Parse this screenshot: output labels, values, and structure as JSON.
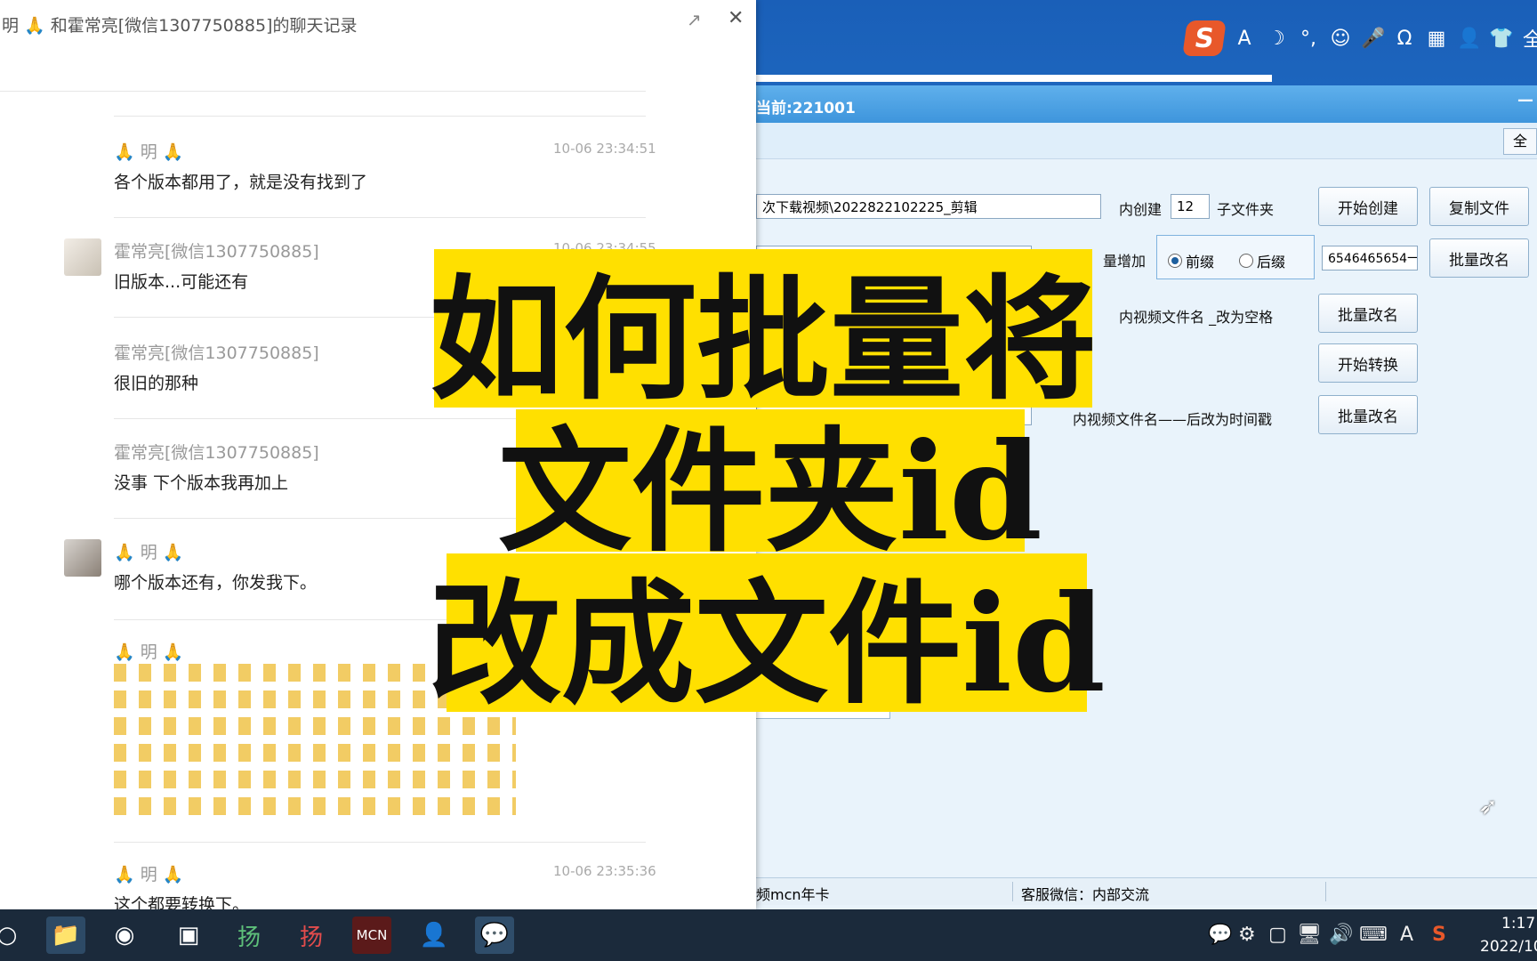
{
  "ime": {
    "logo": "S",
    "icons": [
      "A",
      "☽",
      "°,",
      "☺",
      "🎤",
      "Ω",
      "▦",
      "👤",
      "👕",
      "全",
      "⁝"
    ]
  },
  "tool": {
    "title": "当前:221001",
    "minimize": "—",
    "tab_label": "全",
    "path_value": "次下载视频\\2022822102225_剪辑",
    "create_label_before": "内创建",
    "create_count": "12",
    "create_label_after": "子文件夹",
    "btn_start_create": "开始创建",
    "btn_copy_files": "复制文件",
    "batch_add_label": "量增加",
    "radio_prefix": "前缀",
    "radio_suffix": "后缀",
    "prefix_value": "6546465654一",
    "btn_batch_rename_1": "批量改名",
    "underscore_label": "内视频文件名 _改为空格",
    "btn_batch_rename_2": "批量改名",
    "btn_start_convert": "开始转换",
    "timestamp_label": "内视频文件名——后改为时间戳",
    "btn_batch_rename_3": "批量改名",
    "status_left": "频mcn年卡",
    "status_mid": "客服微信：内部交流"
  },
  "chat": {
    "title": "明   🙏 和霍常亮[微信1307750885]的聊天记录",
    "close": "✕",
    "share": "↗",
    "messages": [
      {
        "name": "🙏  明  🙏",
        "time": "10-06 23:34:51",
        "text": "各个版本都用了，就是没有找到了"
      },
      {
        "name": "霍常亮[微信1307750885]",
        "time": "10-06 23:34:55",
        "text": "旧版本...可能还有"
      },
      {
        "name": "霍常亮[微信1307750885]",
        "time": "",
        "text": "很旧的那种"
      },
      {
        "name": "霍常亮[微信1307750885]",
        "time": "",
        "text": "没事 下个版本我再加上"
      },
      {
        "name": "🙏  明  🙏",
        "time": "",
        "text": "哪个版本还有，你发我下。"
      },
      {
        "name": "🙏  明  🙏",
        "time": "",
        "text": ""
      },
      {
        "name": "🙏  明  🙏",
        "time": "10-06 23:35:36",
        "text": "这个都要转换下。"
      }
    ]
  },
  "overlay": {
    "line1": "如何批量将",
    "line2": "文件夹id",
    "line3": "改成文件id"
  },
  "taskbar": {
    "search_icon": "○",
    "apps": [
      "📁",
      "◉",
      "▣",
      "扬",
      "扬",
      "MCN",
      "👤",
      "💬"
    ],
    "tray": [
      "💬",
      "⚙",
      "▢",
      "🖥",
      "🔊",
      "⌨",
      "A",
      "S"
    ],
    "time": "1:17",
    "date": "2022/10"
  },
  "colors": {
    "overlay_bg": "#ffe000",
    "tool_title": "#4a9fe2",
    "desktop": "#1f6fc9"
  }
}
